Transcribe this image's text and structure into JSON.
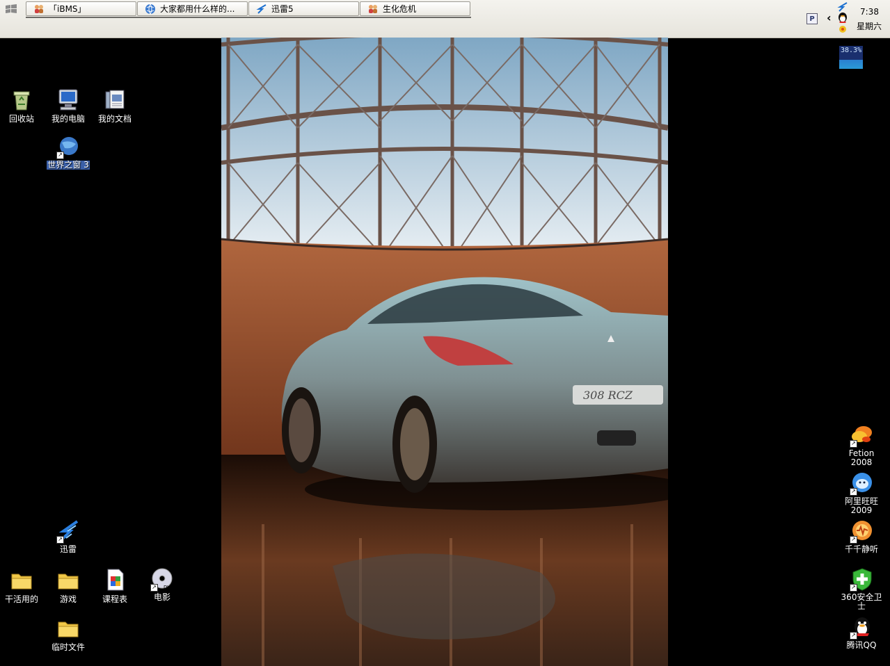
{
  "taskbar": {
    "tasks": [
      {
        "label": "「iBMS」",
        "icon": "users-icon"
      },
      {
        "label": "大家都用什么样的...",
        "icon": "globe-icon"
      },
      {
        "label": "迅雷5",
        "icon": "thunder-icon"
      },
      {
        "label": "生化危机",
        "icon": "users-icon"
      }
    ],
    "tray": {
      "p_label": "P",
      "chevron": "‹",
      "time": "7:38",
      "day": "星期六"
    }
  },
  "cpu_meter": {
    "value": "38.3%"
  },
  "desktop": {
    "left_icons": [
      {
        "label": "回收站",
        "icon": "recycle-bin-icon"
      },
      {
        "label": "我的电脑",
        "icon": "computer-icon"
      },
      {
        "label": "我的文档",
        "icon": "documents-icon"
      },
      {
        "label": "世界之窗 3",
        "icon": "browser-globe-icon"
      },
      {
        "label": "迅雷",
        "icon": "thunder-icon"
      },
      {
        "label": "干活用的",
        "icon": "folder-icon"
      },
      {
        "label": "游戏",
        "icon": "folder-icon"
      },
      {
        "label": "课程表",
        "icon": "document-icon"
      },
      {
        "label": "电影",
        "icon": "dvd-icon"
      },
      {
        "label": "临时文件",
        "icon": "folder-icon"
      }
    ],
    "right_icons": [
      {
        "label": "Fetion 2008",
        "icon": "fetion-icon"
      },
      {
        "label": "阿里旺旺 2009",
        "icon": "aliwangwang-icon"
      },
      {
        "label": "千千静听",
        "icon": "music-player-icon"
      },
      {
        "label": "360安全卫 士",
        "icon": "shield-plus-icon"
      },
      {
        "label": "腾讯QQ",
        "icon": "qq-penguin-icon"
      }
    ]
  },
  "wallpaper": {
    "plate_text": "308 RCZ"
  }
}
